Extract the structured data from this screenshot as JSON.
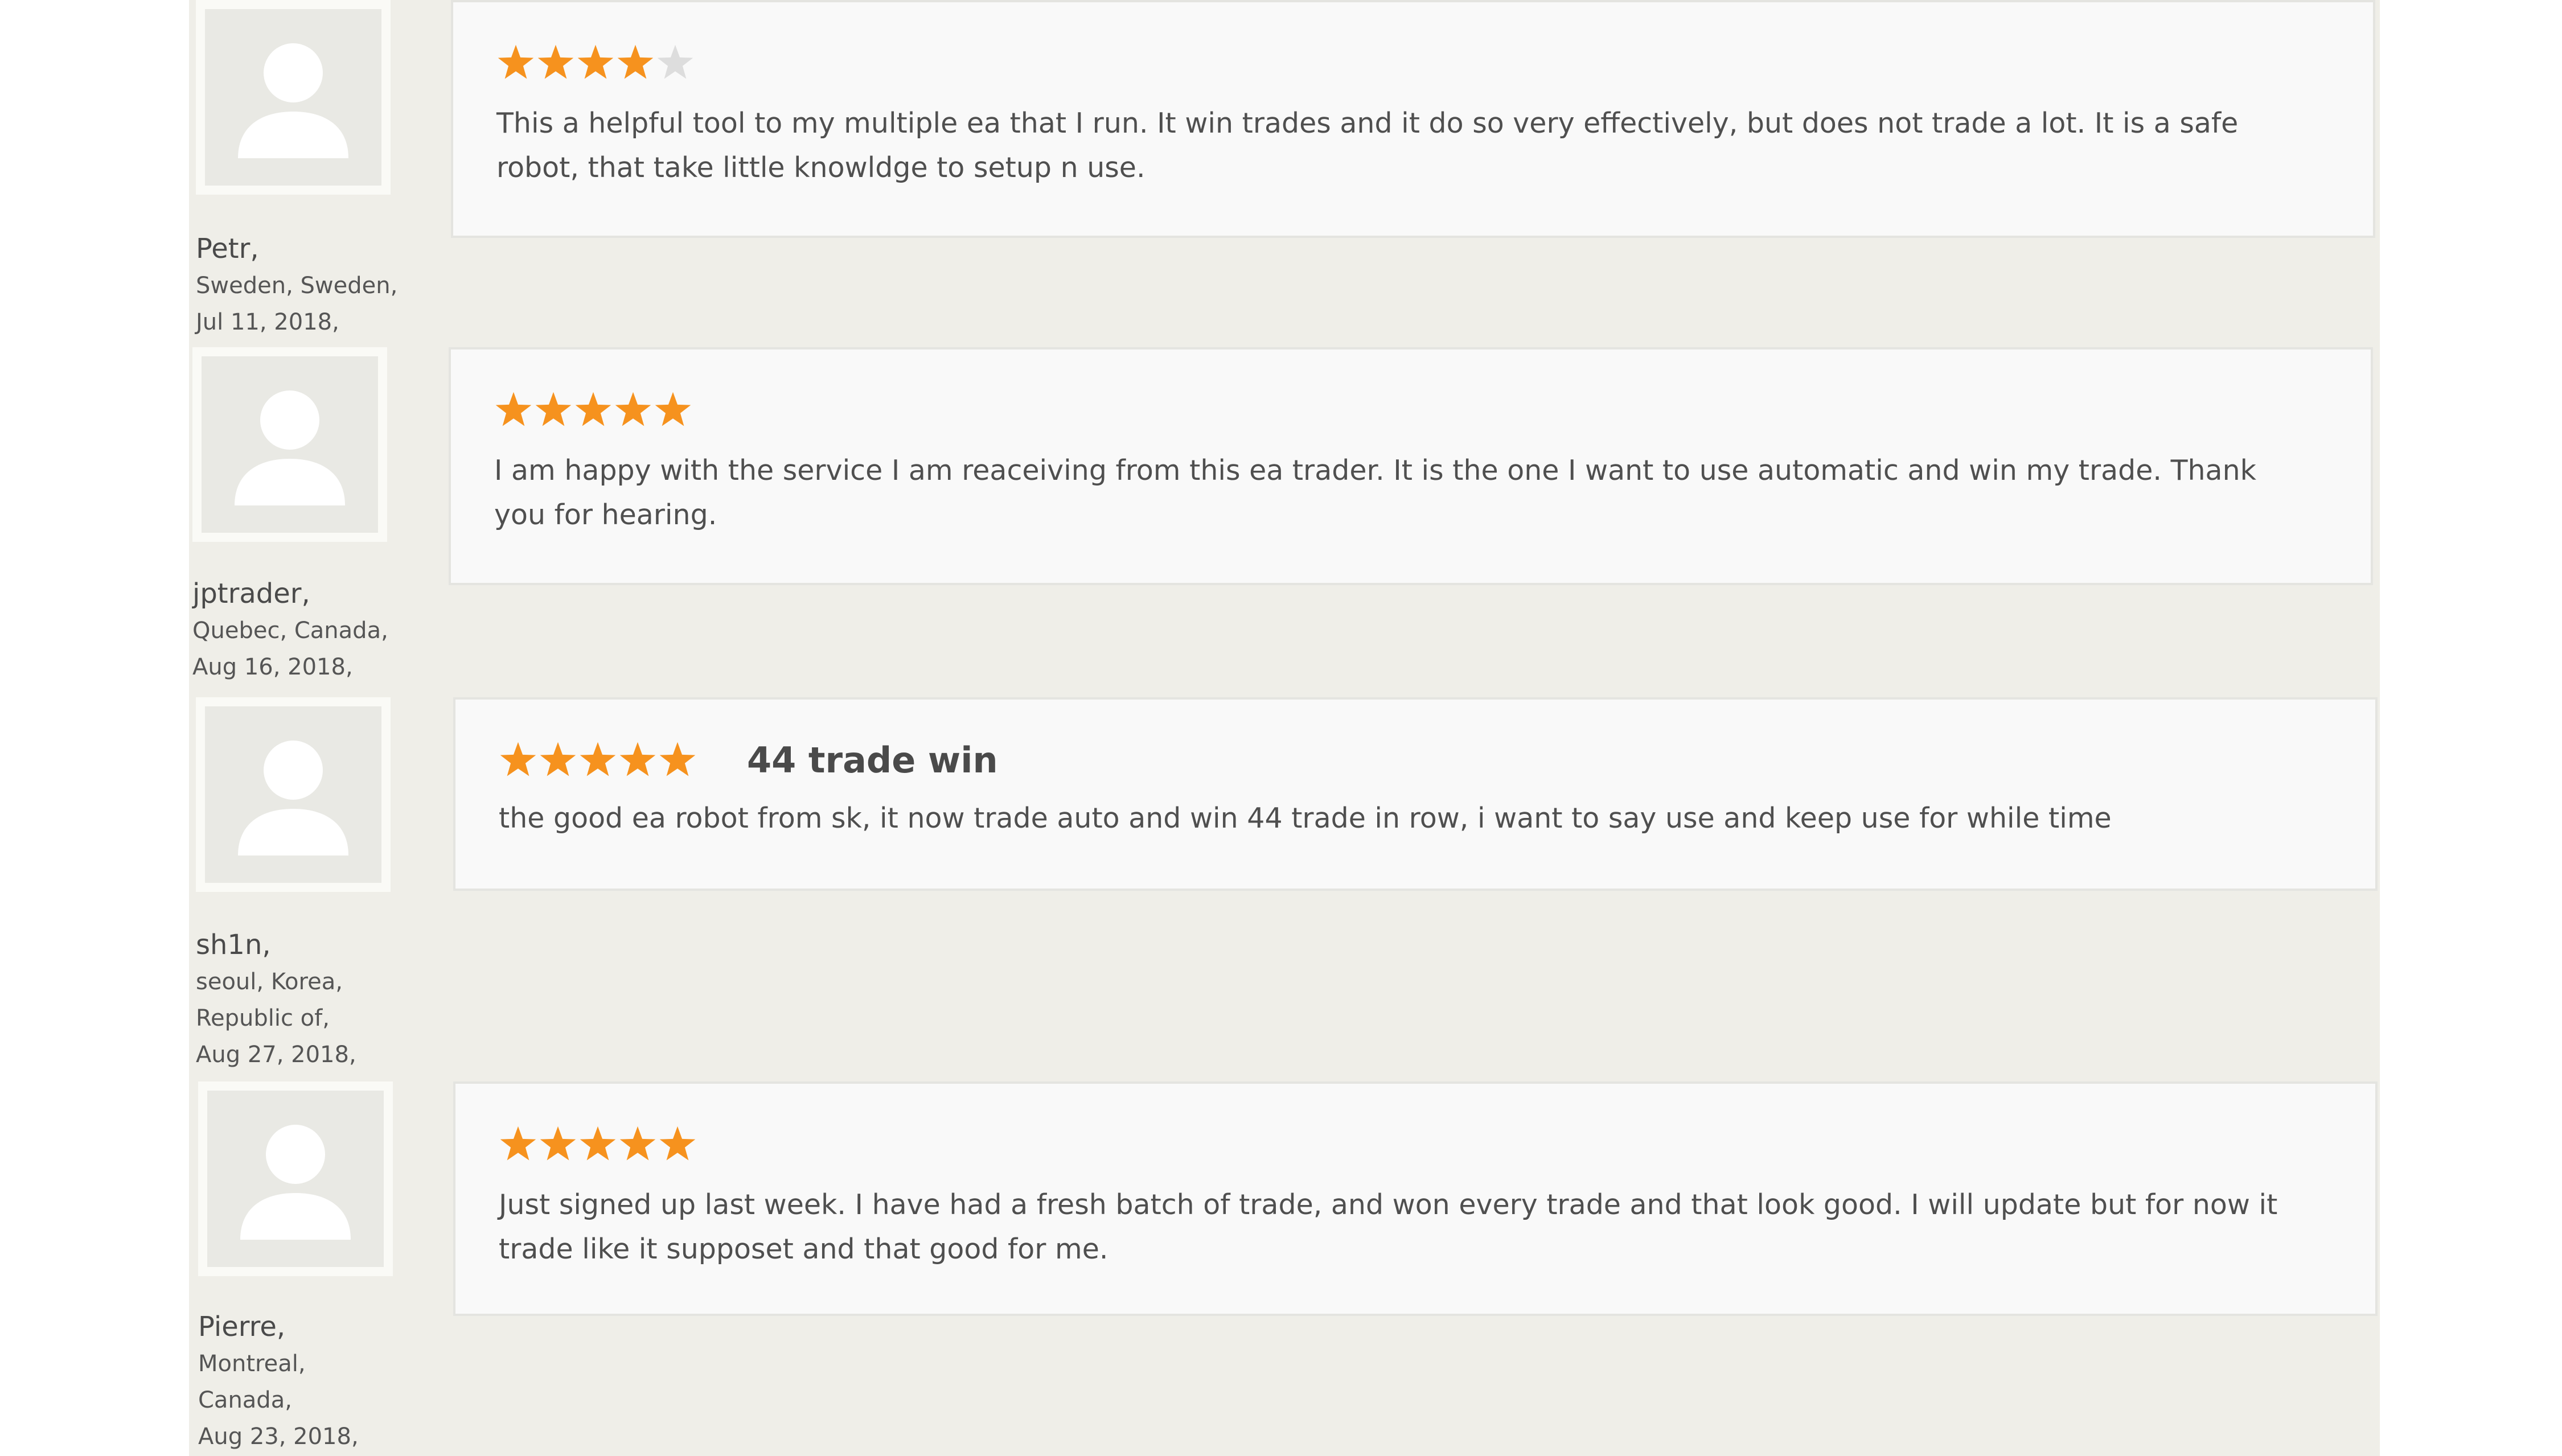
{
  "colors": {
    "star_filled": "#f6921e",
    "star_empty": "#dddddd",
    "page_band": "#efeee8",
    "card_background": "#f9f9f9",
    "text": "#4f4f4f"
  },
  "reviews": [
    {
      "rating": 4,
      "max_rating": 5,
      "headline": "",
      "body": "This a helpful tool to my multiple ea that I run. It win trades and it do so very effectively, but does not trade a lot. It is a safe robot, that take little knowldge to setup n use.",
      "reviewer": {
        "name": "Petr,",
        "lines": [
          "Sweden, Sweden,",
          "Jul 11, 2018,"
        ]
      },
      "avatar_icon": "user-placeholder-icon"
    },
    {
      "rating": 5,
      "max_rating": 5,
      "headline": "",
      "body": "I am happy with the service I am reaceiving from this ea trader. It is the one I want to use automatic and win my trade. Thank you for hearing.",
      "reviewer": {
        "name": "jptrader,",
        "lines": [
          "Quebec, Canada,",
          "Aug 16, 2018,"
        ]
      },
      "avatar_icon": "user-placeholder-icon"
    },
    {
      "rating": 5,
      "max_rating": 5,
      "headline": "44 trade win",
      "body": "the good ea robot from sk, it now trade auto and win 44 trade in row, i want to say use and keep use for while time",
      "reviewer": {
        "name": "sh1n,",
        "lines": [
          "seoul, Korea,",
          "Republic of,",
          "Aug 27, 2018,"
        ]
      },
      "avatar_icon": "user-placeholder-icon"
    },
    {
      "rating": 5,
      "max_rating": 5,
      "headline": "",
      "body": "Just signed up last week. I have had a fresh batch of trade, and won every trade and that look good. I will update but for now it trade like it supposet and that good for me.",
      "reviewer": {
        "name": "Pierre,",
        "lines": [
          "Montreal,",
          "Canada,",
          "Aug 23, 2018,"
        ]
      },
      "avatar_icon": "user-placeholder-icon"
    }
  ]
}
